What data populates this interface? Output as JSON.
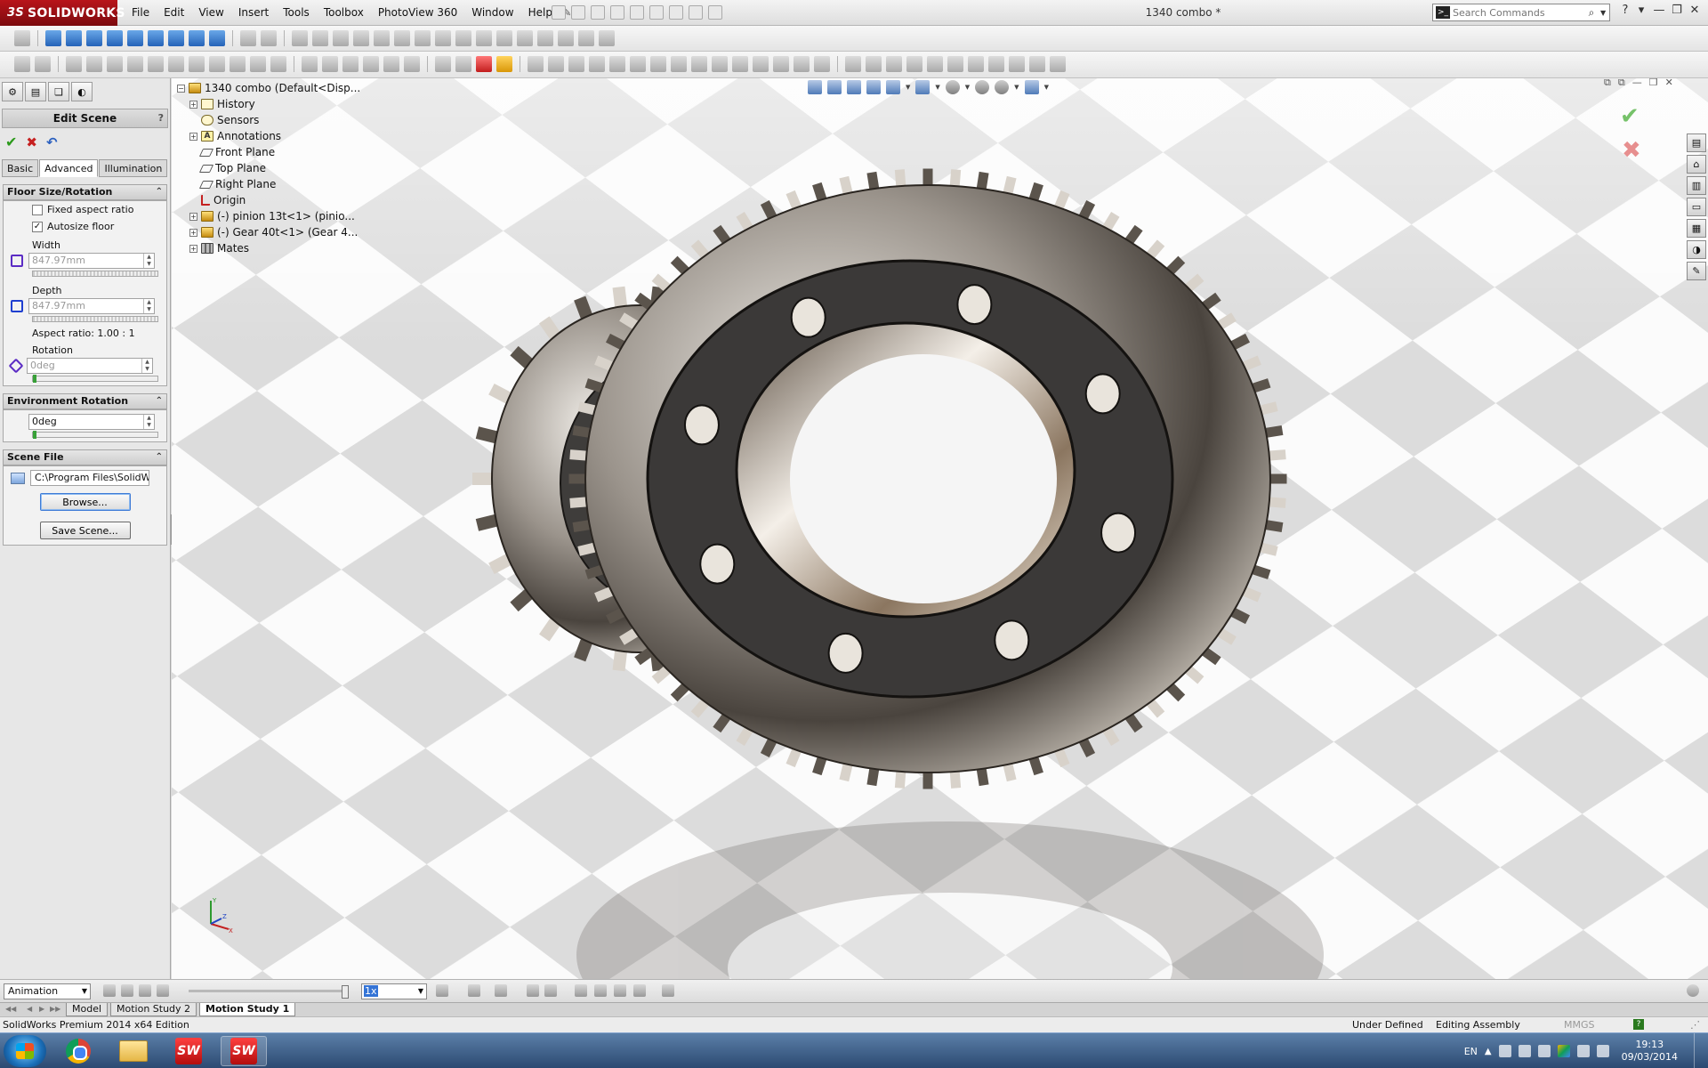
{
  "app": {
    "brand": "SOLIDWORKS",
    "document_title": "1340 combo *",
    "menu": [
      "File",
      "Edit",
      "View",
      "Insert",
      "Tools",
      "Toolbox",
      "PhotoView 360",
      "Window",
      "Help"
    ],
    "search_placeholder": "Search Commands"
  },
  "property_manager": {
    "title": "Edit Scene",
    "tabs": [
      "Basic",
      "Advanced",
      "Illumination"
    ],
    "active_tab": "Advanced",
    "floor_group": {
      "title": "Floor Size/Rotation",
      "fixed_aspect_label": "Fixed aspect ratio",
      "fixed_aspect_checked": false,
      "autosize_label": "Autosize floor",
      "autosize_checked": true,
      "width_label": "Width",
      "width_value": "847.97mm",
      "depth_label": "Depth",
      "depth_value": "847.97mm",
      "aspect_text": "Aspect ratio: 1.00 : 1",
      "rotation_label": "Rotation",
      "rotation_value": "0deg"
    },
    "environment_group": {
      "title": "Environment Rotation",
      "value": "0deg"
    },
    "scene_file_group": {
      "title": "Scene File",
      "path": "C:\\Program Files\\SolidWo",
      "browse_label": "Browse...",
      "save_label": "Save Scene..."
    }
  },
  "feature_tree": {
    "root": "1340 combo  (Default<Disp...",
    "items": [
      {
        "label": "History",
        "icon": "history-icon",
        "expandable": true
      },
      {
        "label": "Sensors",
        "icon": "sensors-icon",
        "expandable": false
      },
      {
        "label": "Annotations",
        "icon": "annotations-icon",
        "expandable": true
      },
      {
        "label": "Front Plane",
        "icon": "plane-icon",
        "expandable": false
      },
      {
        "label": "Top Plane",
        "icon": "plane-icon",
        "expandable": false
      },
      {
        "label": "Right Plane",
        "icon": "plane-icon",
        "expandable": false
      },
      {
        "label": "Origin",
        "icon": "origin-icon",
        "expandable": false
      },
      {
        "label": "(-) pinion 13t<1> (pinio...",
        "icon": "part-icon",
        "expandable": true
      },
      {
        "label": "(-) Gear 40t<1> (Gear 4...",
        "icon": "part-icon",
        "expandable": true
      },
      {
        "label": "Mates",
        "icon": "mates-icon",
        "expandable": true
      }
    ]
  },
  "animation": {
    "mode": "Animation",
    "speed": "1x",
    "tabs": [
      "Model",
      "Motion Study 2",
      "Motion Study 1"
    ],
    "active_tab": "Motion Study 1"
  },
  "status": {
    "edition": "SolidWorks Premium 2014 x64 Edition",
    "defined": "Under Defined",
    "mode": "Editing Assembly",
    "units": "MMGS"
  },
  "taskbar": {
    "language": "EN",
    "time": "19:13",
    "date": "09/03/2014",
    "sw_label": "SW"
  },
  "colors": {
    "brand_red": "#b8141a",
    "accept_green": "#2c9a1c",
    "cancel_red": "#c62020"
  }
}
